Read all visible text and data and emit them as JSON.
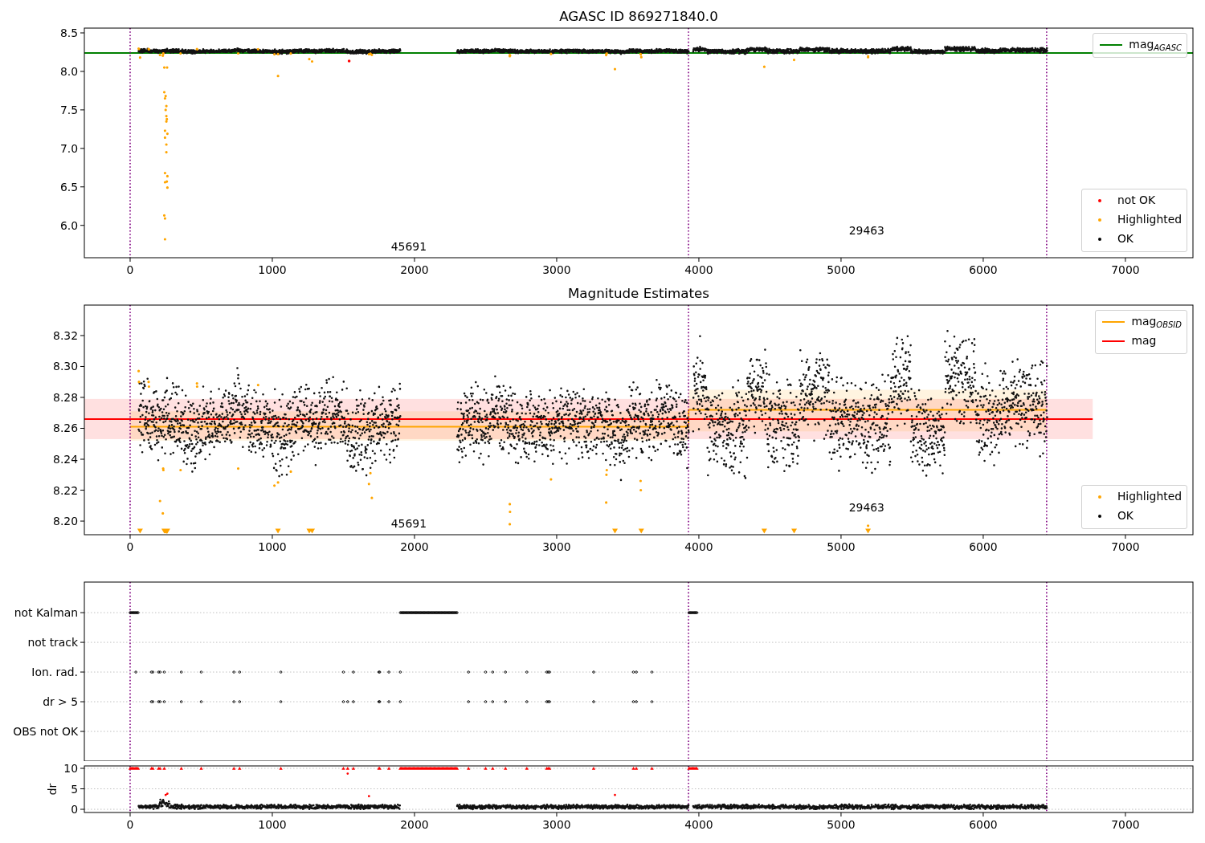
{
  "figure": {
    "panels": [
      {
        "kind": "magnitude",
        "chart_data": {
          "type": "line",
          "title": "AGASC ID 869271840.0",
          "x": [
            -322,
            7475
          ],
          "series": [
            {
              "name": "mag$_{AGASC}$",
              "color": "#008000",
              "values": [
                8.24,
                8.24
              ]
            }
          ],
          "xlim": [
            -322,
            7475
          ],
          "ylim": [
            5.58,
            8.5625
          ],
          "xticks": [
            0,
            1000,
            2000,
            3000,
            4000,
            5000,
            6000,
            7000
          ],
          "yticks": [
            {
              "value": 6,
              "label": "6.0"
            },
            {
              "value": 6.5,
              "label": "6.5"
            },
            {
              "value": 7,
              "label": "7.0"
            },
            {
              "value": 7.5,
              "label": "7.5"
            },
            {
              "value": 8,
              "label": "8.0"
            },
            {
              "value": 8.5,
              "label": "8.5"
            }
          ],
          "ref_lines": [
            {
              "axis": "x",
              "value": 0,
              "color": "#800080"
            },
            {
              "axis": "x",
              "value": 3927,
              "color": "#800080"
            },
            {
              "axis": "x",
              "value": 6446,
              "color": "#800080"
            }
          ],
          "annotations": [
            "45691",
            "29463"
          ],
          "legend": "upper right"
        },
        "legend": [
          {
            "label": "not OK",
            "color": "#ff0000"
          },
          {
            "label": "Highlighted",
            "color": "#ffa500"
          },
          {
            "label": "OK",
            "color": "#000000"
          }
        ]
      },
      {
        "kind": "magnitude",
        "chart_data": {
          "type": "line",
          "title": "Magnitude Estimates",
          "x": [
            -322,
            0,
            3927,
            3928,
            6446,
            6770
          ],
          "series": [
            {
              "name": "mag$_{OBSID}$",
              "color": "#ffa500",
              "values": [
                null,
                8.261,
                8.261,
                8.272,
                8.272,
                null
              ]
            },
            {
              "name": "mag",
              "color": "#ff0000",
              "values": [
                8.266,
                8.266,
                8.266,
                8.266,
                8.266,
                8.266
              ]
            }
          ],
          "xlim": [
            -322,
            7475
          ],
          "ylim": [
            8.1912,
            8.3397
          ],
          "xticks": [
            0,
            1000,
            2000,
            3000,
            4000,
            5000,
            6000,
            7000
          ],
          "yticks": [
            {
              "value": 8.2,
              "label": "8.20"
            },
            {
              "value": 8.22,
              "label": "8.22"
            },
            {
              "value": 8.24,
              "label": "8.24"
            },
            {
              "value": 8.26,
              "label": "8.26"
            },
            {
              "value": 8.28,
              "label": "8.28"
            },
            {
              "value": 8.3,
              "label": "8.30"
            },
            {
              "value": 8.32,
              "label": "8.32"
            }
          ],
          "bands": [
            {
              "axis": "y",
              "from": 8.253,
              "to": 8.279,
              "color": "#ff0000"
            },
            {
              "axis": "y",
              "from": 8.252,
              "to": 8.271,
              "color": "#ffa500"
            },
            {
              "axis": "y",
              "from": 8.258,
              "to": 8.285,
              "color": "#ffa500"
            }
          ],
          "ref_lines": [
            {
              "axis": "x",
              "value": 0,
              "color": "#800080"
            },
            {
              "axis": "x",
              "value": 3927,
              "color": "#800080"
            },
            {
              "axis": "x",
              "value": 6446,
              "color": "#800080"
            }
          ],
          "annotations": [
            "45691",
            "29463"
          ],
          "legend": "upper right"
        },
        "legend": [
          {
            "label": "Highlighted",
            "color": "#ffa500"
          },
          {
            "label": "OK",
            "color": "#000000"
          }
        ]
      },
      {
        "kind": "flags",
        "chart_data": {
          "type": "scatter",
          "orientation": "horizontal",
          "grid": true,
          "xlim": [
            -322,
            7475
          ],
          "categories": [
            "not Kalman",
            "not track",
            "Ion. rad.",
            "dr > 5",
            "OBS not OK"
          ],
          "ref_lines": [
            {
              "axis": "x",
              "value": 0,
              "color": "#800080"
            },
            {
              "axis": "x",
              "value": 3927,
              "color": "#800080"
            },
            {
              "axis": "x",
              "value": 6446,
              "color": "#800080"
            }
          ]
        }
      },
      {
        "kind": "dr",
        "chart_data": {
          "type": "scatter",
          "ylabel": "dr",
          "grid": true,
          "xlim": [
            -322,
            7475
          ],
          "ylim": [
            -0.78,
            10.59
          ],
          "xticks": [
            0,
            1000,
            2000,
            3000,
            4000,
            5000,
            6000,
            7000
          ],
          "yticks": [
            0,
            5,
            10
          ],
          "ref_lines": [
            {
              "axis": "x",
              "value": 0,
              "color": "#800080"
            },
            {
              "axis": "x",
              "value": 3927,
              "color": "#800080"
            },
            {
              "axis": "x",
              "value": 6446,
              "color": "#800080"
            }
          ]
        }
      }
    ]
  }
}
